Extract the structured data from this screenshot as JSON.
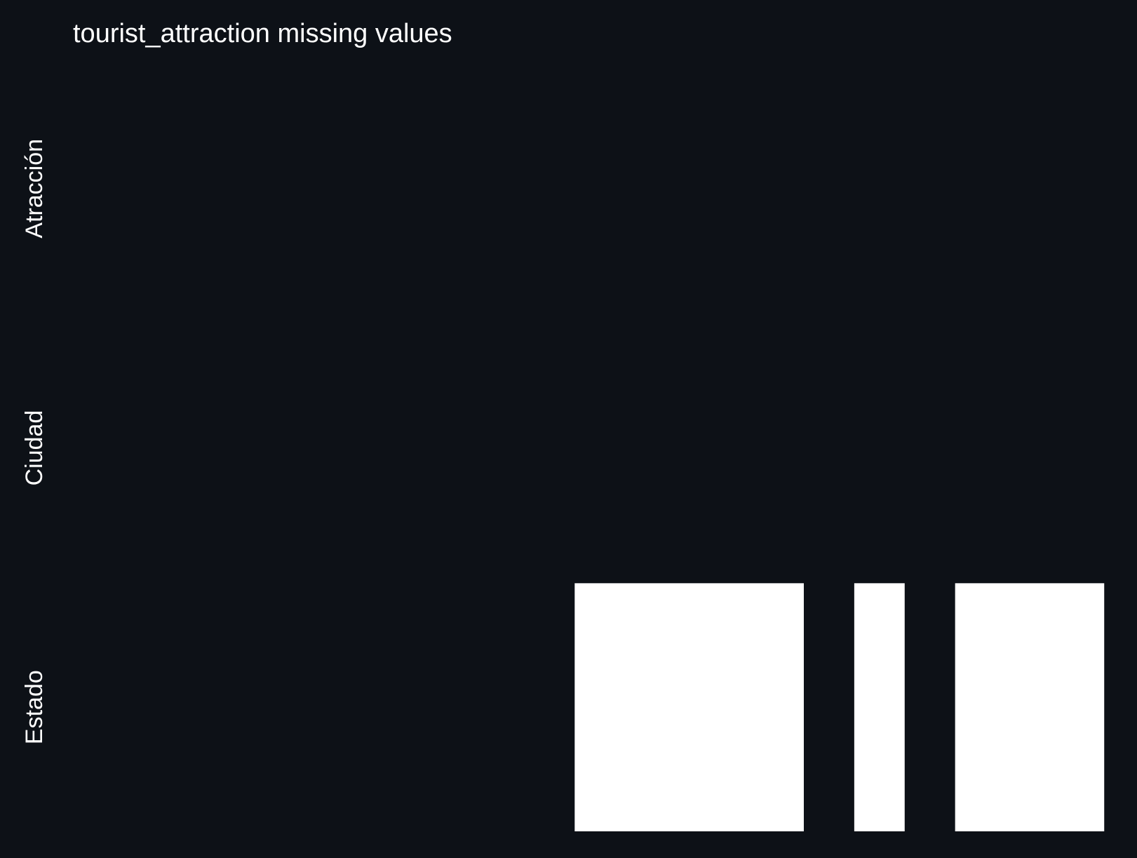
{
  "chart_data": {
    "type": "heatmap",
    "title": "tourist_attraction missing values",
    "rows": [
      "Atracción",
      "Ciudad",
      "Estado"
    ],
    "x_range": [
      0,
      100
    ],
    "missing_cells": [
      {
        "row": "Estado",
        "x_start": 50.5,
        "x_end": 71.4
      },
      {
        "row": "Estado",
        "x_start": 76.0,
        "x_end": 80.6
      },
      {
        "row": "Estado",
        "x_start": 85.2,
        "x_end": 98.8
      }
    ],
    "legend": "none",
    "grid": false
  },
  "colors": {
    "background": "#0d1117",
    "present": "#0d1117",
    "missing": "#ffffff",
    "text": "#ffffff"
  }
}
